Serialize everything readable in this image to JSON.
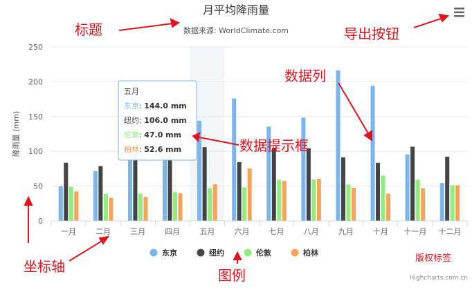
{
  "chart_data": {
    "type": "bar",
    "title": "月平均降雨量",
    "subtitle": "数据来源: WorldClimate.com",
    "ylabel": "降雨量 (mm)",
    "ylim": [
      0,
      250
    ],
    "yticks": [
      0,
      50,
      100,
      150,
      200,
      250
    ],
    "grid": true,
    "legend_position": "bottom-center",
    "categories": [
      "一月",
      "二月",
      "三月",
      "四月",
      "五月",
      "六月",
      "七月",
      "八月",
      "九月",
      "十月",
      "十一月",
      "十二月"
    ],
    "series": [
      {
        "name": "东京",
        "color": "#7cb5ec",
        "values": [
          49.9,
          71.5,
          106.4,
          129.2,
          144.0,
          176.0,
          135.6,
          148.5,
          216.4,
          194.1,
          95.6,
          54.4
        ]
      },
      {
        "name": "纽约",
        "color": "#434348",
        "values": [
          83.6,
          78.8,
          98.5,
          93.4,
          106.0,
          84.5,
          105.0,
          104.3,
          91.2,
          83.5,
          106.6,
          92.3
        ]
      },
      {
        "name": "伦敦",
        "color": "#90ed7d",
        "values": [
          48.9,
          38.8,
          39.3,
          41.4,
          47.0,
          48.3,
          59.0,
          59.6,
          52.4,
          65.2,
          59.3,
          51.2
        ]
      },
      {
        "name": "柏林",
        "color": "#f7a35c",
        "values": [
          42.4,
          33.2,
          34.5,
          39.7,
          52.6,
          75.5,
          57.4,
          60.4,
          47.6,
          39.1,
          46.8,
          51.1
        ]
      }
    ],
    "highlight_category": "五月"
  },
  "tooltip": {
    "header": "五月",
    "rows": [
      {
        "name": "东京",
        "sep": ": ",
        "value": "144.0 mm"
      },
      {
        "name": "纽约",
        "sep": ": ",
        "value": "106.0 mm"
      },
      {
        "name": "伦敦",
        "sep": ": ",
        "value": "47.0 mm"
      },
      {
        "name": "柏林",
        "sep": ": ",
        "value": "52.6 mm"
      }
    ]
  },
  "credits": "Highcharts.com.cn",
  "export_icon": "menu-icon",
  "annotations": {
    "title": "标题",
    "export": "导出按钮",
    "series": "数据列",
    "tooltip": "数据提示框",
    "axis": "坐标轴",
    "legend": "图例",
    "credits": "版权标签"
  },
  "annotation_color": "#e0141e"
}
